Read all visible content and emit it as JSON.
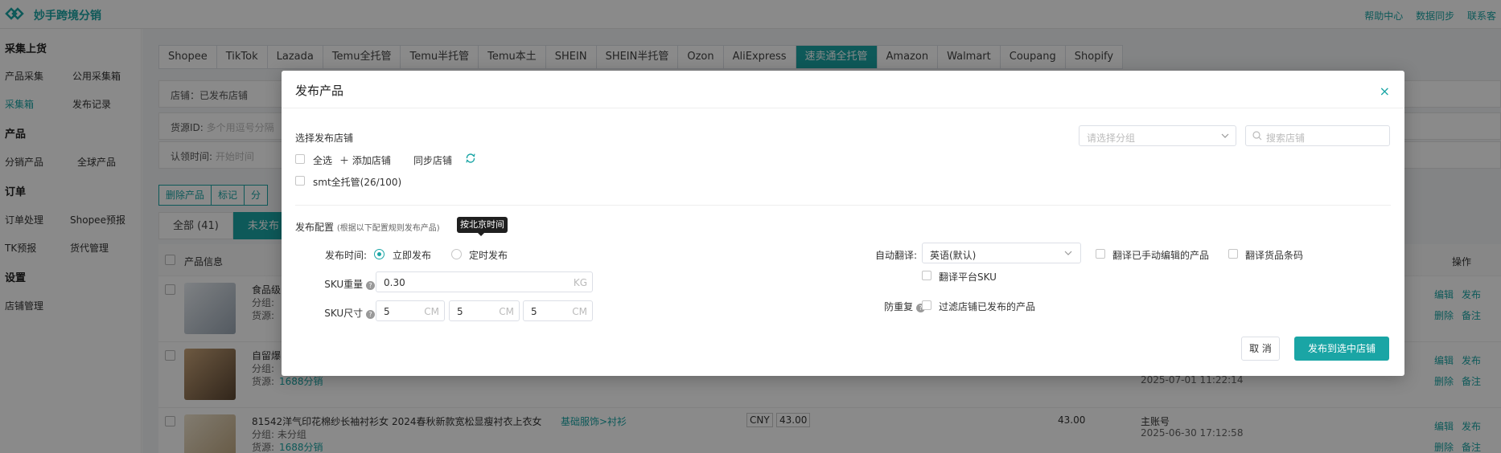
{
  "app": {
    "brand": "妙手跨境分销",
    "top_links": [
      "帮助中心",
      "数据同步",
      "联系客"
    ]
  },
  "sidebar": {
    "sections": [
      {
        "title": "采集上货",
        "items": [
          "产品采集",
          "公用采集箱",
          "采集箱",
          "发布记录"
        ]
      },
      {
        "title": "产品",
        "items": [
          "分销产品",
          "全球产品"
        ]
      },
      {
        "title": "订单",
        "items": [
          "订单处理",
          "Shopee预报",
          "TK预报",
          "货代管理"
        ]
      },
      {
        "title": "设置",
        "items": [
          "店铺管理"
        ]
      }
    ],
    "active": "采集箱"
  },
  "platform_tabs": [
    "Shopee",
    "TikTok",
    "Lazada",
    "Temu全托管",
    "Temu半托管",
    "Temu本土",
    "SHEIN",
    "SHEIN半托管",
    "Ozon",
    "AliExpress",
    "速卖通全托管",
    "Amazon",
    "Walmart",
    "Coupang",
    "Shopify"
  ],
  "active_platform": "速卖通全托管",
  "filters": {
    "store": "店铺：已发布店铺",
    "source_id_label": "货源ID:",
    "source_id_placeholder": "多个用逗号分隔",
    "claim_time_label": "认领时间:",
    "claim_time_placeholder": "开始时间"
  },
  "actions": [
    "删除产品",
    "标记",
    "分"
  ],
  "status_tabs": [
    "全部 (41)",
    "未发布 ("
  ],
  "table": {
    "header": {
      "product_info": "产品信息",
      "operation": "操作"
    },
    "rows": [
      {
        "title": "食品级",
        "group": "分组:",
        "source": "货源:",
        "price": "",
        "date": "",
        "ops": [
          "编辑",
          "发布",
          "删除",
          "备注"
        ]
      },
      {
        "title": "自留爆",
        "group": "分组:",
        "source": "货源:",
        "source_link": "1688分销",
        "date": "2025-07-01 11:22:14",
        "ops": [
          "编辑",
          "发布",
          "删除",
          "备注"
        ]
      },
      {
        "title": "81542洋气印花棉纱长袖衬衫女 2024春秋新款宽松显瘦衬衣上衣女",
        "group": "分组: 未分组",
        "source": "货源:",
        "source_link": "1688分销",
        "category": "基础服饰>衬衫",
        "currency": "CNY",
        "price": "43.00",
        "amount": "43.00",
        "account": "主账号",
        "date": "2025-06-30 17:12:58",
        "ops": [
          "编辑",
          "发布",
          "删除",
          "备注"
        ]
      }
    ]
  },
  "modal": {
    "title": "发布产品",
    "close": "×",
    "select_store_label": "选择发布店铺",
    "select_all": "全选",
    "add_store": "添加店铺",
    "sync_store": "同步店铺",
    "store_option": "smt全托管(26/100)",
    "group_placeholder": "请选择分组",
    "search_placeholder": "搜索店铺",
    "config_title": "发布配置",
    "config_note": "(根据以下配置规则发布产品)",
    "tooltip": "按北京时间",
    "publish_time_label": "发布时间:",
    "publish_now": "立即发布",
    "publish_scheduled": "定时发布",
    "sku_weight_label": "SKU重量",
    "sku_weight_value": "0.30",
    "sku_weight_unit": "KG",
    "sku_size_label": "SKU尺寸",
    "sku_size_values": [
      "5",
      "5",
      "5"
    ],
    "sku_size_unit": "CM",
    "auto_translate_label": "自动翻译:",
    "auto_translate_value": "英语(默认)",
    "translate_edited": "翻译已手动编辑的产品",
    "translate_barcode": "翻译货品条码",
    "translate_sku": "翻译平台SKU",
    "dedupe_label": "防重复",
    "dedupe_option": "过滤店铺已发布的产品",
    "cancel": "取 消",
    "submit": "发布到选中店铺"
  },
  "colors": {
    "accent": "#1aa5a5",
    "overlay": "rgba(0,0,0,0.46)"
  }
}
